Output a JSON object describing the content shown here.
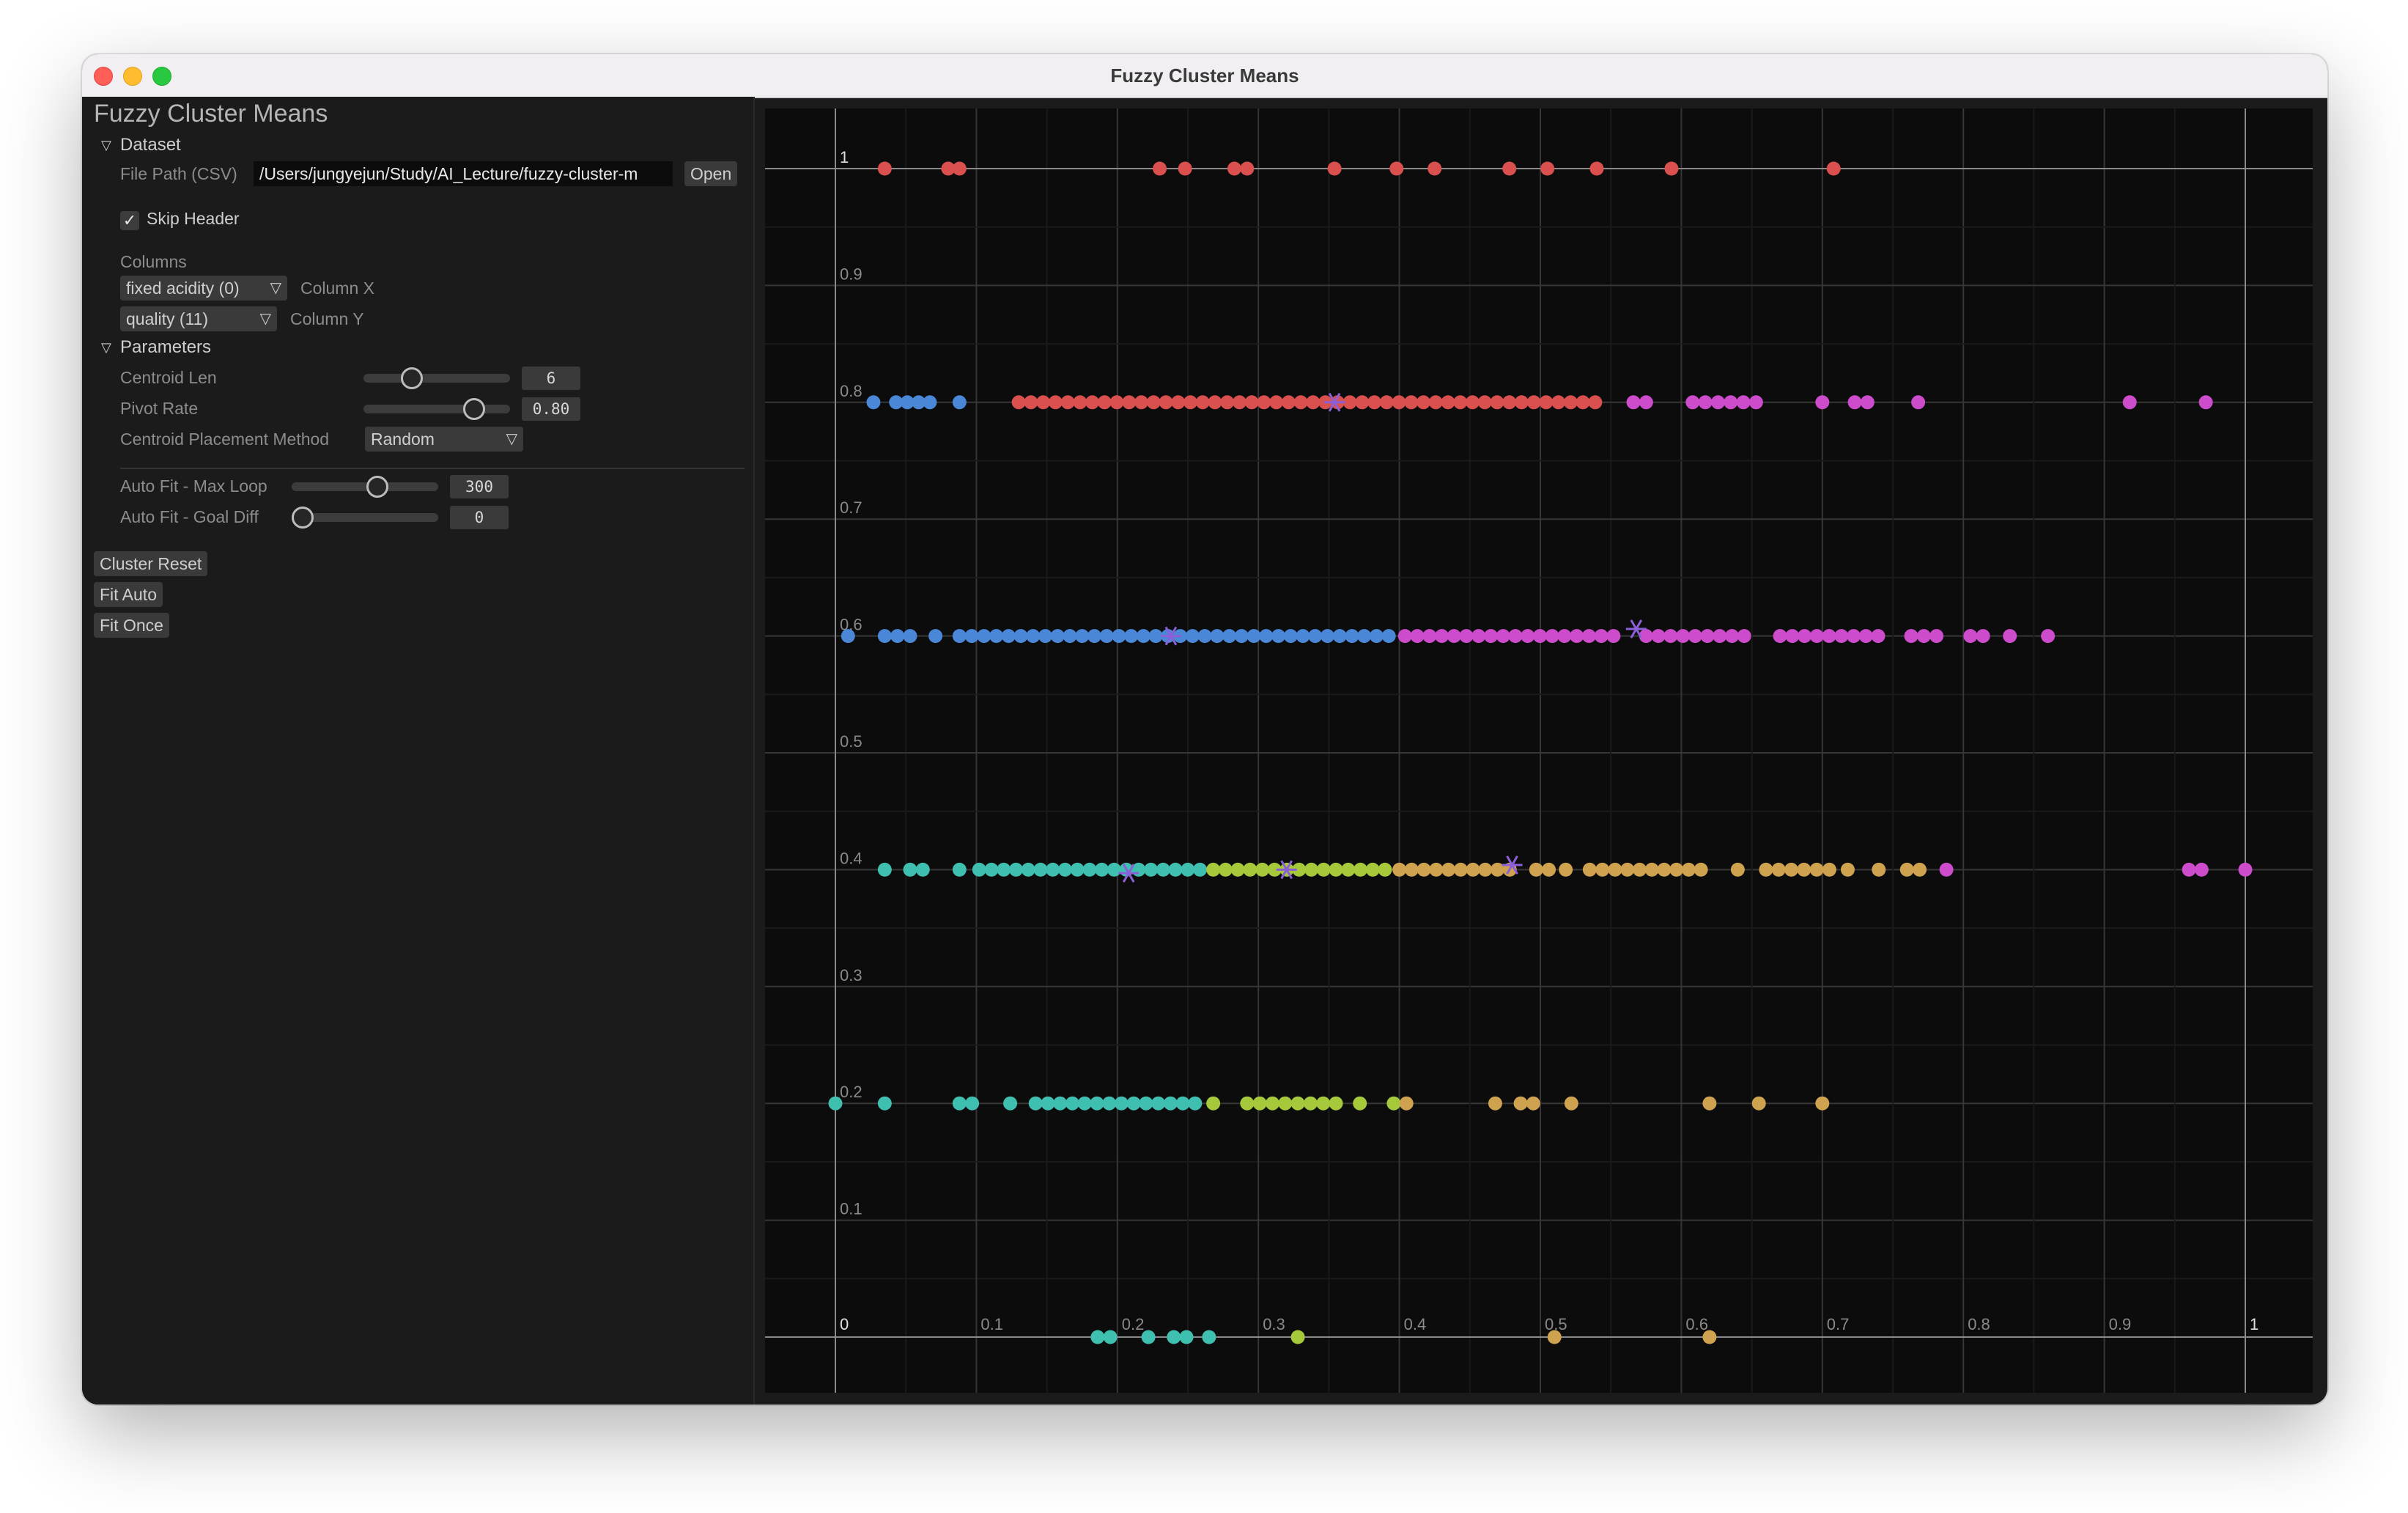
{
  "window": {
    "title": "Fuzzy Cluster Means"
  },
  "panel": {
    "title": "Fuzzy Cluster Means",
    "dataset": {
      "header": "Dataset",
      "file_path_label": "File Path (CSV)",
      "file_path_value": "/Users/jungyejun/Study/AI_Lecture/fuzzy-cluster-m",
      "open_label": "Open",
      "skip_header_label": "Skip Header",
      "skip_header_checked": true,
      "columns_label": "Columns",
      "column_x_value": "fixed acidity (0)",
      "column_x_label": "Column X",
      "column_y_value": "quality (11)",
      "column_y_label": "Column Y"
    },
    "parameters": {
      "header": "Parameters",
      "centroid_len_label": "Centroid Len",
      "centroid_len_value": "6",
      "centroid_len_fraction": 0.3,
      "pivot_rate_label": "Pivot Rate",
      "pivot_rate_value": "0.80",
      "pivot_rate_fraction": 0.8,
      "placement_label": "Centroid Placement Method",
      "placement_value": "Random",
      "max_loop_label": "Auto Fit - Max Loop",
      "max_loop_value": "300",
      "max_loop_fraction": 0.6,
      "goal_diff_label": "Auto Fit - Goal Diff",
      "goal_diff_value": "0",
      "goal_diff_fraction": 0.0
    },
    "buttons": {
      "reset": "Cluster Reset",
      "fit_auto": "Fit Auto",
      "fit_once": "Fit Once"
    }
  },
  "colors": {
    "red": "#d9504f",
    "blue": "#4a87d6",
    "magenta": "#cc4ccc",
    "teal": "#3fbfb0",
    "lime": "#a6c93b",
    "orange": "#cfa24f",
    "centroid": "#8a5fd8"
  },
  "chart_data": {
    "type": "scatter",
    "xlim": [
      0,
      1
    ],
    "ylim": [
      0,
      1
    ],
    "x_ticks": [
      "0",
      "0.1",
      "0.2",
      "0.3",
      "0.4",
      "0.5",
      "0.6",
      "0.7",
      "0.8",
      "0.9",
      "1"
    ],
    "y_ticks": [
      "0",
      "0.1",
      "0.2",
      "0.3",
      "0.4",
      "0.5",
      "0.6",
      "0.7",
      "0.8",
      "0.9",
      "1"
    ],
    "grid": true,
    "series": [
      {
        "y": 1.0,
        "segments": [
          {
            "color": "red",
            "x": [
              0.035,
              0.08,
              0.088,
              0.23,
              0.248,
              0.283,
              0.292,
              0.354,
              0.398,
              0.425,
              0.478,
              0.505,
              0.54,
              0.593,
              0.708
            ]
          }
        ]
      },
      {
        "y": 0.8,
        "segments": [
          {
            "color": "blue",
            "x": [
              0.027,
              0.043,
              0.051,
              0.059,
              0.067,
              0.088
            ]
          },
          {
            "color": "red",
            "range": [
              0.13,
              0.545
            ],
            "step": 0.0087
          },
          {
            "color": "magenta",
            "x": [
              0.566,
              0.575,
              0.608,
              0.617,
              0.626,
              0.635,
              0.644,
              0.653,
              0.7,
              0.723,
              0.732,
              0.768,
              0.918,
              0.972
            ]
          }
        ]
      },
      {
        "y": 0.6,
        "segments": [
          {
            "color": "blue",
            "x": [
              0.009,
              0.035,
              0.044,
              0.053,
              0.071
            ]
          },
          {
            "color": "blue",
            "range": [
              0.088,
              0.395
            ],
            "step": 0.0087
          },
          {
            "color": "magenta",
            "range": [
              0.404,
              0.558
            ],
            "step": 0.0087
          },
          {
            "color": "magenta",
            "range": [
              0.575,
              0.65
            ],
            "step": 0.0087
          },
          {
            "color": "magenta",
            "range": [
              0.67,
              0.745
            ],
            "step": 0.0087
          },
          {
            "color": "magenta",
            "x": [
              0.763,
              0.772,
              0.781,
              0.805,
              0.814,
              0.833,
              0.86
            ]
          }
        ]
      },
      {
        "y": 0.4,
        "segments": [
          {
            "color": "teal",
            "x": [
              0.035,
              0.053,
              0.062,
              0.088
            ]
          },
          {
            "color": "teal",
            "range": [
              0.102,
              0.26
            ],
            "step": 0.0087
          },
          {
            "color": "lime",
            "range": [
              0.268,
              0.39
            ],
            "step": 0.0087
          },
          {
            "color": "orange",
            "range": [
              0.4,
              0.48
            ],
            "step": 0.0087
          },
          {
            "color": "orange",
            "x": [
              0.497,
              0.506,
              0.518,
              0.535,
              0.544
            ]
          },
          {
            "color": "orange",
            "range": [
              0.553,
              0.62
            ],
            "step": 0.0087
          },
          {
            "color": "orange",
            "x": [
              0.64,
              0.66,
              0.669,
              0.678,
              0.687,
              0.696,
              0.705,
              0.718,
              0.74,
              0.76,
              0.769
            ]
          },
          {
            "color": "magenta",
            "x": [
              0.788,
              0.96,
              0.969,
              1.0
            ]
          }
        ]
      },
      {
        "y": 0.2,
        "segments": [
          {
            "color": "teal",
            "x": [
              0.0,
              0.035,
              0.088,
              0.097,
              0.124
            ]
          },
          {
            "color": "teal",
            "range": [
              0.142,
              0.26
            ],
            "step": 0.0087
          },
          {
            "color": "lime",
            "x": [
              0.268,
              0.292,
              0.301,
              0.31,
              0.319,
              0.328,
              0.337,
              0.346,
              0.355,
              0.372,
              0.396
            ]
          },
          {
            "color": "orange",
            "x": [
              0.405,
              0.468,
              0.486,
              0.495,
              0.522,
              0.62,
              0.655,
              0.7
            ]
          }
        ]
      },
      {
        "y": 0.0,
        "segments": [
          {
            "color": "teal",
            "x": [
              0.186,
              0.195,
              0.222,
              0.24,
              0.249,
              0.265
            ]
          },
          {
            "color": "lime",
            "x": [
              0.328
            ]
          },
          {
            "color": "orange",
            "x": [
              0.51,
              0.62
            ]
          }
        ]
      }
    ],
    "centroids": [
      {
        "x": 0.354,
        "y": 0.8
      },
      {
        "x": 0.238,
        "y": 0.6
      },
      {
        "x": 0.568,
        "y": 0.606
      },
      {
        "x": 0.208,
        "y": 0.397
      },
      {
        "x": 0.32,
        "y": 0.4
      },
      {
        "x": 0.48,
        "y": 0.404
      }
    ]
  }
}
